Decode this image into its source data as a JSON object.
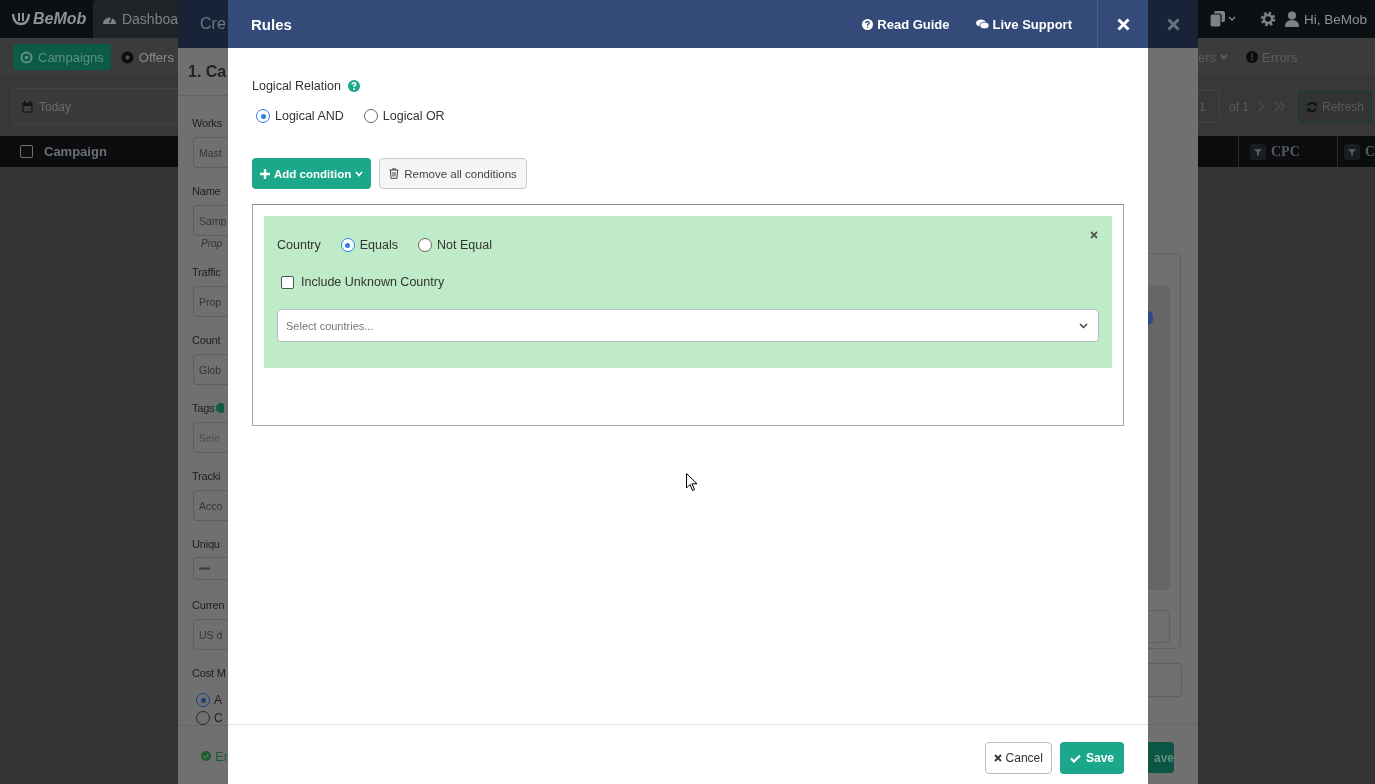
{
  "app": {
    "logo": "BeMob",
    "nav_tab": "Dashboa",
    "sections": [
      {
        "label": "Campaigns",
        "selected": true
      },
      {
        "label": "Offers",
        "selected": false
      }
    ],
    "date_filter": "Today",
    "table_first_column": "Campaign",
    "select_all_checked": false,
    "user_greeting": "Hi, BeMob",
    "right_menu": [
      {
        "label": "ers",
        "kind": "dropdown"
      },
      {
        "label": "Errors",
        "kind": "alert"
      }
    ],
    "page": "1",
    "page_total": "of 1",
    "refresh": "Refresh",
    "columns": [
      "CPC",
      "C"
    ]
  },
  "campaign_modal": {
    "title": "Cre",
    "step": "1. Ca",
    "fields": [
      {
        "kind": "label",
        "text": "Works"
      },
      {
        "kind": "input",
        "text": "Mast"
      },
      {
        "kind": "label",
        "text": "Name"
      },
      {
        "kind": "input",
        "text": "Samp"
      },
      {
        "kind": "hint",
        "text": "Prop"
      },
      {
        "kind": "label",
        "text": "Traffic"
      },
      {
        "kind": "input",
        "text": "Prop"
      },
      {
        "kind": "label",
        "text": "Count"
      },
      {
        "kind": "input",
        "text": "Glob"
      },
      {
        "kind": "label",
        "text": "Tags",
        "help": true
      },
      {
        "kind": "placeholder",
        "text": "Sele"
      },
      {
        "kind": "label",
        "text": "Tracki"
      },
      {
        "kind": "input",
        "text": "Acco"
      },
      {
        "kind": "label",
        "text": "Uniqu"
      },
      {
        "kind": "stepper"
      },
      {
        "kind": "label",
        "text": "Curren"
      },
      {
        "kind": "input",
        "text": "US d"
      },
      {
        "kind": "label",
        "text": "Cost M"
      }
    ],
    "cost_model": [
      {
        "label": "A",
        "selected": true
      },
      {
        "label": "C",
        "selected": false
      }
    ],
    "status": "Er",
    "save": "ave"
  },
  "rules": {
    "title": "Rules",
    "links": [
      {
        "label": "Read Guide",
        "kind": "guide"
      },
      {
        "label": "Live Support",
        "kind": "support"
      }
    ],
    "relation_label": "Logical Relation",
    "relations": [
      {
        "label": "Logical AND",
        "selected": true
      },
      {
        "label": "Logical OR",
        "selected": false
      }
    ],
    "add_button": "Add condition",
    "remove_button": "Remove all conditions",
    "conditions": [
      {
        "name": "Country",
        "operators": [
          {
            "label": "Equals",
            "selected": true
          },
          {
            "label": "Not Equal",
            "selected": false
          }
        ],
        "include_unknown": {
          "label": "Include Unknown Country",
          "checked": false
        },
        "select_placeholder": "Select countries..."
      }
    ],
    "cancel": "Cancel",
    "save": "Save"
  }
}
